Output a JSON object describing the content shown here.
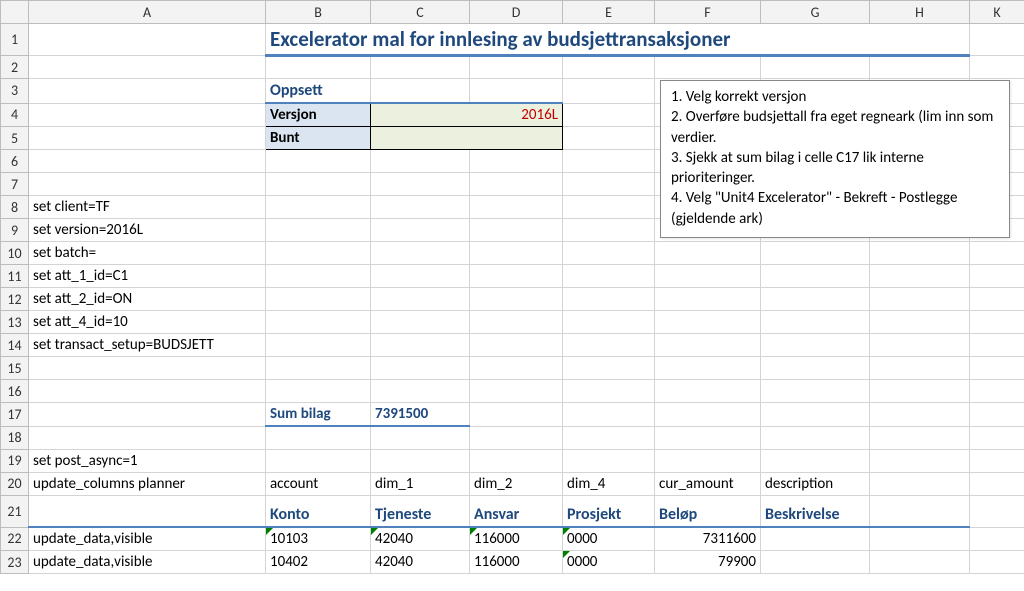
{
  "columns": [
    "A",
    "B",
    "C",
    "D",
    "E",
    "F",
    "G",
    "H",
    "K"
  ],
  "rows": [
    "1",
    "2",
    "3",
    "4",
    "5",
    "6",
    "7",
    "8",
    "9",
    "10",
    "11",
    "12",
    "13",
    "14",
    "15",
    "16",
    "17",
    "18",
    "19",
    "20",
    "21",
    "22",
    "23"
  ],
  "title": "Excelerator mal for innlesing av budsjettransaksjoner",
  "oppsett": {
    "header": "Oppsett",
    "versjon_label": "Versjon",
    "versjon_value": "2016L",
    "bunt_label": "Bunt",
    "bunt_value": ""
  },
  "info": {
    "l1": "1. Velg korrekt versjon",
    "l2": "2. Overføre budsjettall fra eget regneark (lim inn som verdier.",
    "l3": "3. Sjekk at sum bilag i celle C17  lik interne prioriteringer.",
    "l4": "4. Velg \"Unit4 Excelerator\" -  Bekreft - Postlegge (gjeldende ark)"
  },
  "commands": {
    "r8": "set client=TF",
    "r9": "set version=2016L",
    "r10": "set batch=",
    "r11": "set att_1_id=C1",
    "r12": "set att_2_id=ON",
    "r13": "set att_4_id=10",
    "r14": "set transact_setup=BUDSJETT",
    "r19": "set post_async=1",
    "r20": "update_columns planner"
  },
  "sumbilag": {
    "label": "Sum bilag",
    "value": "7391500"
  },
  "colmap": {
    "b20": "account",
    "c20": "dim_1",
    "d20": "dim_2",
    "e20": "dim_4",
    "f20": "cur_amount",
    "g20": "description"
  },
  "headers": {
    "b": "Konto",
    "c": "Tjeneste",
    "d": "Ansvar",
    "e": "Prosjekt",
    "f": "Beløp",
    "g": "Beskrivelse"
  },
  "datarows": [
    {
      "a": "update_data,visible",
      "b": "10103",
      "c": "42040",
      "d": "116000",
      "e": "0000",
      "f": "7311600",
      "g": ""
    },
    {
      "a": "update_data,visible",
      "b": "10402",
      "c": "42040",
      "d": "116000",
      "e": "0000",
      "f": "79900",
      "g": ""
    }
  ]
}
